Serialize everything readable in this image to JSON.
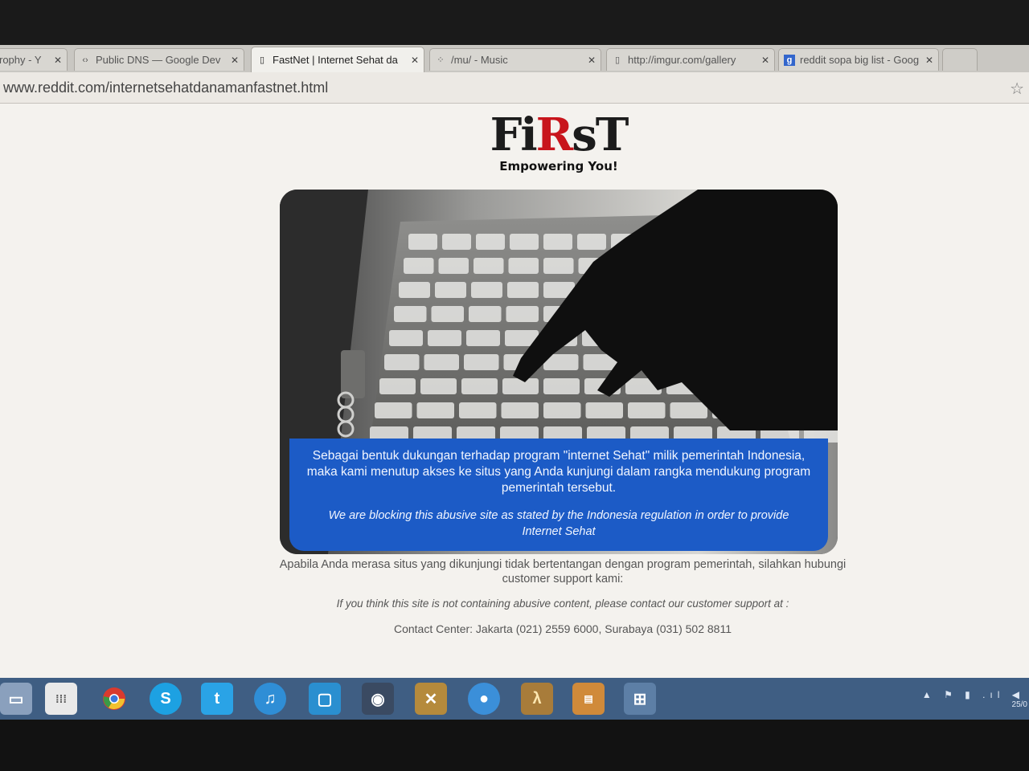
{
  "browser": {
    "tabs": [
      {
        "title": "rophy - Y",
        "active": false,
        "icon": "page-icon"
      },
      {
        "title": "Public DNS — Google Dev",
        "active": false,
        "icon": "code-icon"
      },
      {
        "title": "FastNet | Internet Sehat da",
        "active": true,
        "icon": "page-icon"
      },
      {
        "title": "/mu/ - Music",
        "active": false,
        "icon": "grid-icon"
      },
      {
        "title": "http://imgur.com/gallery",
        "active": false,
        "icon": "page-icon"
      },
      {
        "title": "reddit sopa big list - Goog",
        "active": false,
        "icon": "google-icon"
      }
    ],
    "close_glyph": "✕",
    "url": "www.reddit.com/internetsehatdanamanfastnet.html",
    "bookmark_icon": "☆"
  },
  "page": {
    "logo": {
      "text_before": "Fi",
      "text_r": "R",
      "text_after": "sT",
      "tagline": "Empowering You!"
    },
    "notice_id": "Sebagai bentuk dukungan terhadap program \"internet Sehat\" milik pemerintah Indonesia, maka kami menutup akses ke situs yang Anda kunjungi dalam rangka mendukung program pemerintah tersebut.",
    "notice_en": "We are blocking this abusive site as stated by the Indonesia regulation in order to provide Internet Sehat",
    "contact_id": "Apabila Anda merasa situs yang dikunjungi tidak bertentangan dengan program pemerintah, silahkan hubungi customer support kami:",
    "contact_en": "If you think this site is not containing abusive content, please contact our customer support at :",
    "contact_center": "Contact Center: Jakarta (021) 2559 6000, Surabaya (031) 502 8811"
  },
  "taskbar": {
    "apps": [
      "explorer",
      "apps-grid",
      "chrome",
      "skype",
      "twitter",
      "itunes",
      "editor",
      "steam",
      "game",
      "messenger",
      "half-life",
      "books",
      "windows-app"
    ],
    "app_glyphs": {
      "skype": "S",
      "half-life": "λ",
      "twitter": "t"
    },
    "accent": "#3f5e83",
    "tray": "▲ ⚑ ▮ .ıl ◀",
    "date": "25/0"
  },
  "colors": {
    "banner": "#1c5bc6",
    "logo_red": "#c8151c"
  }
}
